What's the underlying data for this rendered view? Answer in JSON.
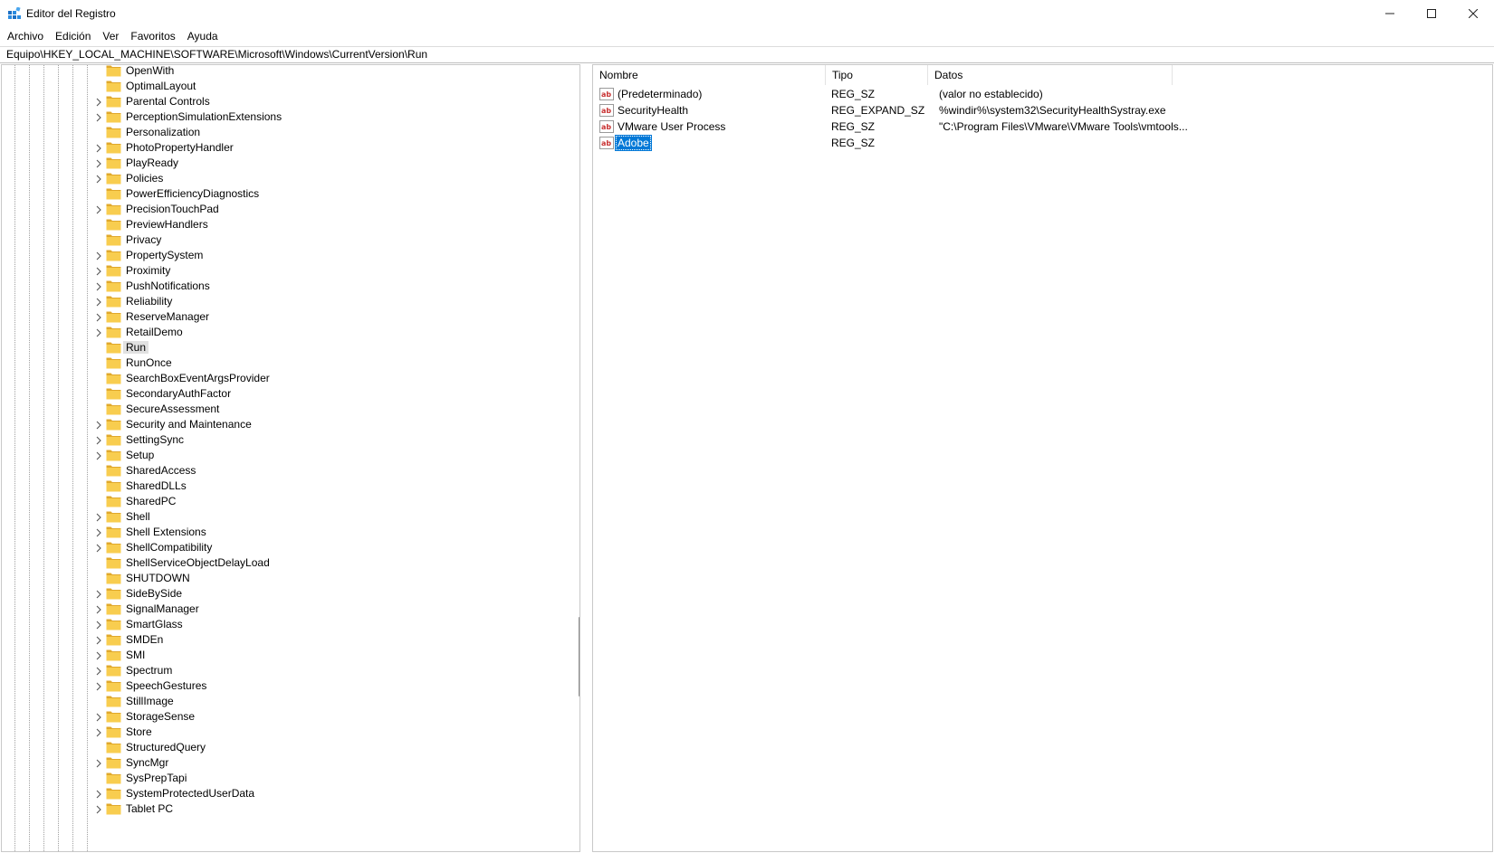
{
  "window": {
    "title": "Editor del Registro",
    "minimize_glyph": "—",
    "maximize_glyph": "☐",
    "close_glyph": "✕"
  },
  "menu": [
    "Archivo",
    "Edición",
    "Ver",
    "Favoritos",
    "Ayuda"
  ],
  "address": "Equipo\\HKEY_LOCAL_MACHINE\\SOFTWARE\\Microsoft\\Windows\\CurrentVersion\\Run",
  "tree": {
    "selected": "Run",
    "items": [
      {
        "label": "OpenWith",
        "expandable": false
      },
      {
        "label": "OptimalLayout",
        "expandable": false
      },
      {
        "label": "Parental Controls",
        "expandable": true
      },
      {
        "label": "PerceptionSimulationExtensions",
        "expandable": true
      },
      {
        "label": "Personalization",
        "expandable": false
      },
      {
        "label": "PhotoPropertyHandler",
        "expandable": true
      },
      {
        "label": "PlayReady",
        "expandable": true
      },
      {
        "label": "Policies",
        "expandable": true
      },
      {
        "label": "PowerEfficiencyDiagnostics",
        "expandable": false
      },
      {
        "label": "PrecisionTouchPad",
        "expandable": true
      },
      {
        "label": "PreviewHandlers",
        "expandable": false
      },
      {
        "label": "Privacy",
        "expandable": false
      },
      {
        "label": "PropertySystem",
        "expandable": true
      },
      {
        "label": "Proximity",
        "expandable": true
      },
      {
        "label": "PushNotifications",
        "expandable": true
      },
      {
        "label": "Reliability",
        "expandable": true
      },
      {
        "label": "ReserveManager",
        "expandable": true
      },
      {
        "label": "RetailDemo",
        "expandable": true
      },
      {
        "label": "Run",
        "expandable": false
      },
      {
        "label": "RunOnce",
        "expandable": false
      },
      {
        "label": "SearchBoxEventArgsProvider",
        "expandable": false
      },
      {
        "label": "SecondaryAuthFactor",
        "expandable": false
      },
      {
        "label": "SecureAssessment",
        "expandable": false
      },
      {
        "label": "Security and Maintenance",
        "expandable": true
      },
      {
        "label": "SettingSync",
        "expandable": true
      },
      {
        "label": "Setup",
        "expandable": true
      },
      {
        "label": "SharedAccess",
        "expandable": false
      },
      {
        "label": "SharedDLLs",
        "expandable": false
      },
      {
        "label": "SharedPC",
        "expandable": false
      },
      {
        "label": "Shell",
        "expandable": true
      },
      {
        "label": "Shell Extensions",
        "expandable": true
      },
      {
        "label": "ShellCompatibility",
        "expandable": true
      },
      {
        "label": "ShellServiceObjectDelayLoad",
        "expandable": false
      },
      {
        "label": "SHUTDOWN",
        "expandable": false
      },
      {
        "label": "SideBySide",
        "expandable": true
      },
      {
        "label": "SignalManager",
        "expandable": true
      },
      {
        "label": "SmartGlass",
        "expandable": true
      },
      {
        "label": "SMDEn",
        "expandable": true
      },
      {
        "label": "SMI",
        "expandable": true
      },
      {
        "label": "Spectrum",
        "expandable": true
      },
      {
        "label": "SpeechGestures",
        "expandable": true
      },
      {
        "label": "StillImage",
        "expandable": false
      },
      {
        "label": "StorageSense",
        "expandable": true
      },
      {
        "label": "Store",
        "expandable": true
      },
      {
        "label": "StructuredQuery",
        "expandable": false
      },
      {
        "label": "SyncMgr",
        "expandable": true
      },
      {
        "label": "SysPrepTapi",
        "expandable": false
      },
      {
        "label": "SystemProtectedUserData",
        "expandable": true
      },
      {
        "label": "Tablet PC",
        "expandable": true
      }
    ]
  },
  "values": {
    "columns": {
      "name": "Nombre",
      "type": "Tipo",
      "data": "Datos"
    },
    "rows": [
      {
        "name": "(Predeterminado)",
        "type": "REG_SZ",
        "data": "(valor no establecido)",
        "selected": false
      },
      {
        "name": "SecurityHealth",
        "type": "REG_EXPAND_SZ",
        "data": "%windir%\\system32\\SecurityHealthSystray.exe",
        "selected": false
      },
      {
        "name": "VMware User Process",
        "type": "REG_SZ",
        "data": "\"C:\\Program Files\\VMware\\VMware Tools\\vmtools...",
        "selected": false
      },
      {
        "name": "Adobe",
        "type": "REG_SZ",
        "data": "",
        "selected": true
      }
    ]
  },
  "icons": {
    "app": "registry-editor-icon",
    "folder": "folder-icon",
    "chevron": "chevron-right-icon",
    "string_value": "ab-string-value-icon"
  },
  "colors": {
    "folder": "#f8cd4f",
    "folder_dark": "#e0a82b",
    "selection": "#0078d7",
    "tree_selection": "#e1e1e1",
    "ab_red": "#c83232"
  }
}
